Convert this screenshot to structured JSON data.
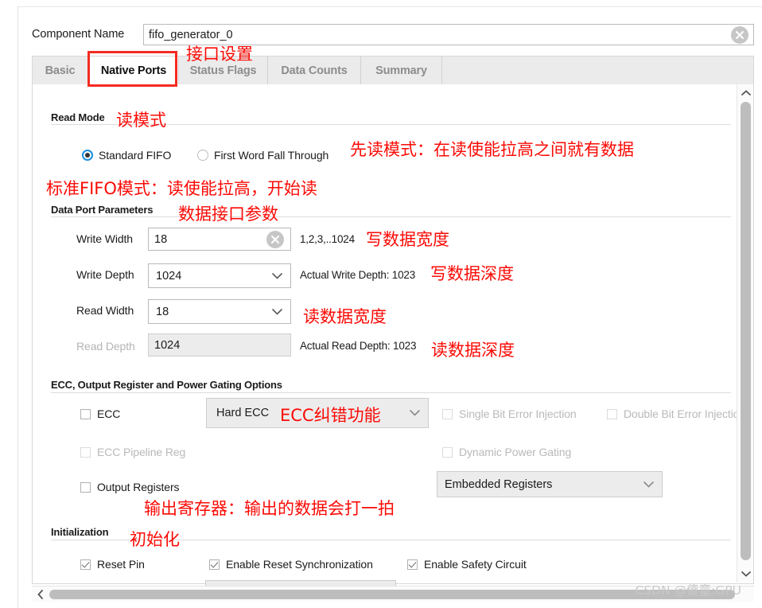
{
  "component": {
    "label": "Component Name",
    "value": "fifo_generator_0",
    "clear_icon": "clear-circle-icon"
  },
  "tabs": [
    {
      "label": "Basic",
      "active": false
    },
    {
      "label": "Native Ports",
      "active": true
    },
    {
      "label": "Status Flags",
      "active": false
    },
    {
      "label": "Data Counts",
      "active": false
    },
    {
      "label": "Summary",
      "active": false
    }
  ],
  "sections": {
    "read_mode": {
      "title": "Read Mode",
      "options": [
        {
          "label": "Standard FIFO",
          "selected": true
        },
        {
          "label": "First Word Fall Through",
          "selected": false
        }
      ]
    },
    "data_port": {
      "title": "Data Port Parameters",
      "rows": [
        {
          "label": "Write Width",
          "value": "18",
          "hint": "1,2,3,..1024",
          "type": "text",
          "disabled": false
        },
        {
          "label": "Write Depth",
          "value": "1024",
          "hint": "Actual Write Depth: 1023",
          "type": "combo",
          "disabled": false
        },
        {
          "label": "Read Width",
          "value": "18",
          "hint": "",
          "type": "combo",
          "disabled": false
        },
        {
          "label": "Read Depth",
          "value": "1024",
          "hint": "Actual Read Depth: 1023",
          "type": "readonly",
          "disabled": true
        }
      ]
    },
    "ecc": {
      "title": "ECC, Output Register and Power Gating Options",
      "ecc_checkbox": {
        "label": "ECC",
        "checked": false,
        "disabled": false
      },
      "ecc_mode_combo": {
        "value": "Hard ECC",
        "disabled": true
      },
      "single_bit": {
        "label": "Single Bit Error Injection",
        "checked": false,
        "disabled": true
      },
      "double_bit": {
        "label": "Double Bit Error Injection",
        "checked": false,
        "disabled": true
      },
      "pipeline_reg": {
        "label": "ECC Pipeline Reg",
        "checked": false,
        "disabled": true
      },
      "dynamic_power": {
        "label": "Dynamic Power Gating",
        "checked": false,
        "disabled": true
      },
      "output_registers": {
        "label": "Output Registers",
        "checked": false,
        "disabled": false
      },
      "output_reg_combo": {
        "value": "Embedded Registers",
        "disabled": true
      }
    },
    "initialization": {
      "title": "Initialization",
      "checkboxes": [
        {
          "label": "Reset Pin",
          "checked": true
        },
        {
          "label": "Enable Reset Synchronization",
          "checked": true
        },
        {
          "label": "Enable Safety Circuit",
          "checked": true
        }
      ]
    }
  },
  "annotations": {
    "interface_settings": "接口设置",
    "read_mode": "读模式",
    "fwft_desc": "先读模式：在读使能拉高之间就有数据",
    "standard_fifo_desc": "标准FIFO模式：读使能拉高，开始读",
    "data_port_params": "数据接口参数",
    "write_width": "写数据宽度",
    "write_depth": "写数据深度",
    "read_width": "读数据宽度",
    "read_depth": "读数据深度",
    "ecc_function": "ECC纠错功能",
    "output_registers_desc": "输出寄存器：输出的数据会打一拍",
    "initialization": "初始化"
  },
  "colors": {
    "annotation_red": "#fb0b06",
    "highlight_red": "#f42b22",
    "radio_blue": "#1a8fe0",
    "panel_bg": "#ffffff",
    "tabbar_bg": "#ebebeb"
  },
  "scrollbars": {
    "vertical_up_icon": "chevron-up-icon",
    "vertical_down_icon": "chevron-down-icon",
    "horizontal_left_icon": "chevron-left-icon"
  },
  "watermark": "CSDN @傻童:GPU"
}
